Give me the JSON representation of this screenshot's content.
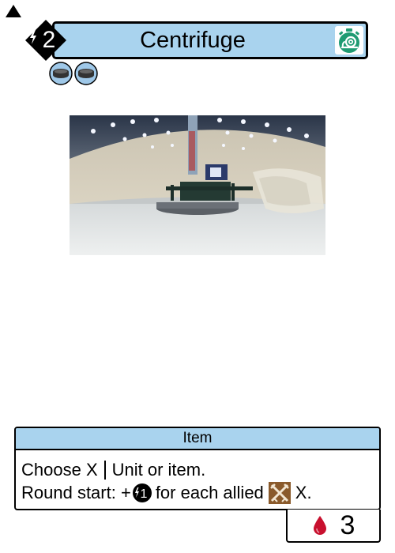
{
  "card": {
    "name": "Centrifuge",
    "cost": "2",
    "type_line": "Item",
    "rules_line1_a": "Choose X",
    "rules_line1_b": "Unit or item.",
    "rules_line2_a": "Round start: +",
    "rules_line2_token": "1",
    "rules_line2_b": "for each allied",
    "rules_line2_c": "X.",
    "stat_value": "3"
  },
  "icons": {
    "corner": "triangle-marker-icon",
    "cost": "lightning-bolt-icon",
    "title": "snail-timer-icon",
    "coins": [
      "coin-icon",
      "coin-icon"
    ],
    "energy": "energy-token-icon",
    "class": "crossed-tools-icon",
    "stat": "blood-drop-icon"
  },
  "colors": {
    "banner": "#a9d3ee",
    "timer_green": "#1f9b72",
    "coin_blue": "#9fc8e8",
    "class_brown": "#8a5a2b",
    "drop_red": "#c8102e"
  }
}
